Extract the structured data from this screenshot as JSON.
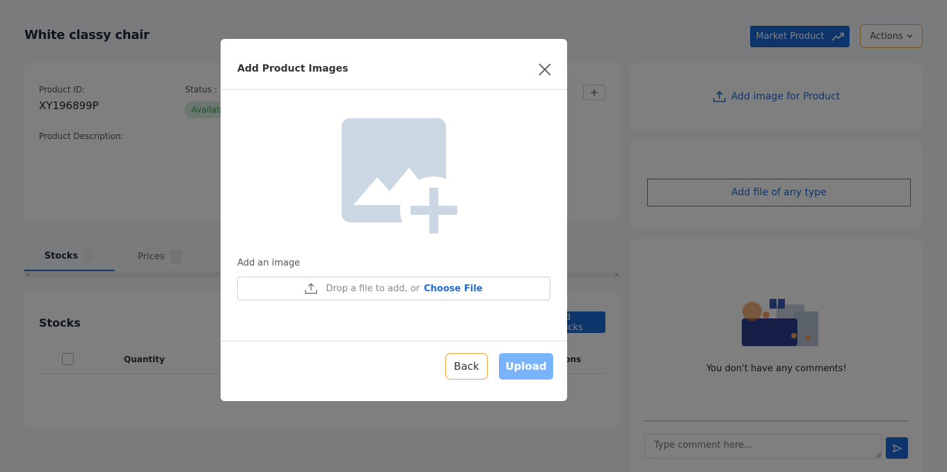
{
  "page": {
    "title": "White classy chair",
    "market_button": "Market Product",
    "actions_button": "Actions",
    "info": {
      "product_id_label": "Product ID:",
      "product_id": "XY196899P",
      "status_label": "Status :",
      "status_value": "Available",
      "description_label": "Product Description:"
    },
    "tabs": [
      {
        "label": "Stocks"
      },
      {
        "label": "Prices"
      }
    ],
    "stocks": {
      "title": "Stocks",
      "add_button": "Add Stocks",
      "columns": [
        "Quantity",
        "Actions"
      ]
    },
    "side": {
      "add_image": "Add image for Product",
      "add_file": "Add file of any type",
      "no_comments": "You don't have any comments!",
      "comment_placeholder": "Type comment here..."
    }
  },
  "modal": {
    "title": "Add Product Images",
    "add_label": "Add an image",
    "drop_text": "Drop a file to add, or",
    "choose_file": "Choose File",
    "back": "Back",
    "upload": "Upload"
  },
  "colors": {
    "primary": "#1d6bd6",
    "upload_disabled": "#79b3fa",
    "accent_border": "#f0a53c",
    "placeholder_icon": "#cbd7e3"
  }
}
